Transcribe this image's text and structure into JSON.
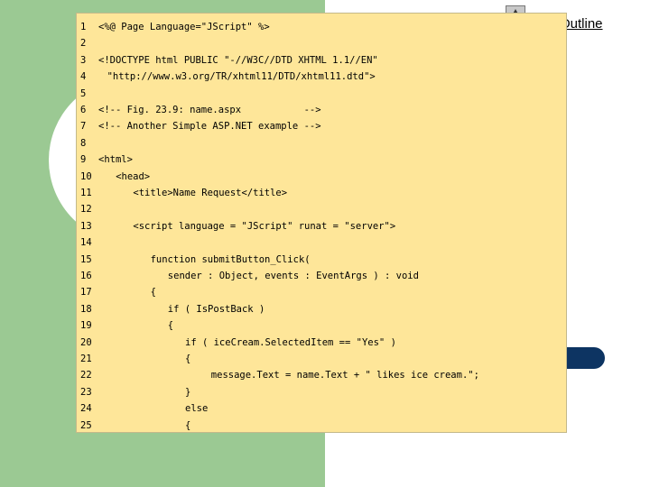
{
  "slide": {
    "outline_link": "Outline",
    "accent_colors": {
      "left_panel": "#9bc993",
      "pill": "#0d3462",
      "code_background": "#fee699"
    }
  },
  "scrollbar": {
    "up_icon": "triangle-up-icon"
  },
  "code": {
    "lines": [
      {
        "number": "1",
        "text": "<%@ Page Language=\"JScript\" %>",
        "indent": 0
      },
      {
        "number": "2",
        "text": "",
        "indent": 0
      },
      {
        "number": "3",
        "text": "<!DOCTYPE html PUBLIC \"-//W3C//DTD XHTML 1.1//EN\"",
        "indent": 0
      },
      {
        "number": "4",
        "text": "\"http://www.w3.org/TR/xhtml11/DTD/xhtml11.dtd\">",
        "indent": 1
      },
      {
        "number": "5",
        "text": "",
        "indent": 0
      },
      {
        "number": "6",
        "text": "<!-- Fig. 23.9: name.aspx           -->",
        "indent": 0
      },
      {
        "number": "7",
        "text": "<!-- Another Simple ASP.NET example -->",
        "indent": 0
      },
      {
        "number": "8",
        "text": "",
        "indent": 0
      },
      {
        "number": "9",
        "text": "<html>",
        "indent": 0
      },
      {
        "number": "10",
        "text": "<head>",
        "indent": 2
      },
      {
        "number": "11",
        "text": "<title>Name Request</title>",
        "indent": 4
      },
      {
        "number": "12",
        "text": "",
        "indent": 0
      },
      {
        "number": "13",
        "text": "<script language = \"JScript\" runat = \"server\">",
        "indent": 4
      },
      {
        "number": "14",
        "text": "",
        "indent": 0
      },
      {
        "number": "15",
        "text": "function submitButton_Click(",
        "indent": 6
      },
      {
        "number": "16",
        "text": "sender : Object, events : EventArgs ) : void",
        "indent": 8
      },
      {
        "number": "17",
        "text": "{",
        "indent": 6
      },
      {
        "number": "18",
        "text": "if ( IsPostBack )",
        "indent": 8
      },
      {
        "number": "19",
        "text": "{",
        "indent": 8
      },
      {
        "number": "20",
        "text": "if ( iceCream.SelectedItem == \"Yes\" )",
        "indent": 10
      },
      {
        "number": "21",
        "text": "{",
        "indent": 10
      },
      {
        "number": "22",
        "text": "message.Text = name.Text + \" likes ice cream.\";",
        "indent": 13
      },
      {
        "number": "23",
        "text": "}",
        "indent": 10
      },
      {
        "number": "24",
        "text": "else",
        "indent": 10
      },
      {
        "number": "25",
        "text": "{",
        "indent": 10
      }
    ]
  }
}
